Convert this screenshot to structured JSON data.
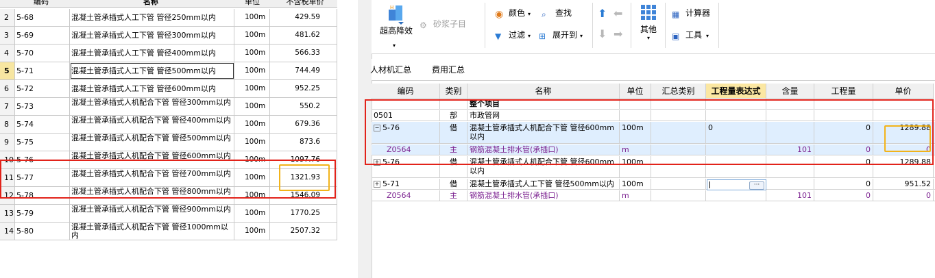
{
  "left_table": {
    "headers": {
      "code": "编码",
      "name": "名称",
      "unit": "单位",
      "price": "不含税单价"
    },
    "rows": [
      {
        "num": "2",
        "code": "5-68",
        "name": "混凝土管承插式人工下管 管径250mm以内",
        "unit": "100m",
        "price": "429.59"
      },
      {
        "num": "3",
        "code": "5-69",
        "name": "混凝土管承插式人工下管 管径300mm以内",
        "unit": "100m",
        "price": "481.62"
      },
      {
        "num": "4",
        "code": "5-70",
        "name": "混凝土管承插式人工下管 管径400mm以内",
        "unit": "100m",
        "price": "566.33"
      },
      {
        "num": "5",
        "code": "5-71",
        "name": "混凝土管承插式人工下管 管径500mm以内",
        "unit": "100m",
        "price": "744.49"
      },
      {
        "num": "6",
        "code": "5-72",
        "name": "混凝土管承插式人工下管 管径600mm以内",
        "unit": "100m",
        "price": "952.25"
      },
      {
        "num": "7",
        "code": "5-73",
        "name": "混凝土管承插式人机配合下管 管径300mm以内",
        "unit": "100m",
        "price": "550.2"
      },
      {
        "num": "8",
        "code": "5-74",
        "name": "混凝土管承插式人机配合下管 管径400mm以内",
        "unit": "100m",
        "price": "679.36"
      },
      {
        "num": "9",
        "code": "5-75",
        "name": "混凝土管承插式人机配合下管 管径500mm以内",
        "unit": "100m",
        "price": "873.6"
      },
      {
        "num": "10",
        "code": "5-76",
        "name": "混凝土管承插式人机配合下管 管径600mm以内",
        "unit": "100m",
        "price": "1097.76"
      },
      {
        "num": "11",
        "code": "5-77",
        "name": "混凝土管承插式人机配合下管 管径700mm以内",
        "unit": "100m",
        "price": "1321.93"
      },
      {
        "num": "12",
        "code": "5-78",
        "name": "混凝土管承插式人机配合下管 管径800mm以内",
        "unit": "100m",
        "price": "1546.09"
      },
      {
        "num": "13",
        "code": "5-79",
        "name": "混凝土管承插式人机配合下管 管径900mm以内",
        "unit": "100m",
        "price": "1770.25"
      },
      {
        "num": "14",
        "code": "5-80",
        "name": "混凝土管承插式人机配合下管 管径1000mm以内",
        "unit": "100m",
        "price": "2507.32"
      }
    ]
  },
  "toolbar": {
    "super_high": "超高降效",
    "mortar": "砂浆子目",
    "color": "颜色",
    "find": "查找",
    "filter": "过滤",
    "expand": "展开到",
    "other": "其他",
    "calculator": "计算器",
    "tools": "工具"
  },
  "tabs": {
    "labor_summary": "人材机汇总",
    "fee_summary": "费用汇总"
  },
  "grid": {
    "headers": {
      "code": "编码",
      "category": "类别",
      "name": "名称",
      "unit": "单位",
      "sum_category": "汇总类别",
      "qty_expr": "工程量表达式",
      "content": "含量",
      "qty": "工程量",
      "price": "单价"
    },
    "rows": [
      {
        "code": "",
        "category": "",
        "name": "整个项目",
        "unit": "",
        "expr": "",
        "content": "",
        "qty": "",
        "price": ""
      },
      {
        "code": "0501",
        "category": "部",
        "name": "市政管网",
        "unit": "",
        "expr": "",
        "content": "",
        "qty": "",
        "price": ""
      },
      {
        "code": "5-76",
        "category": "借",
        "name": "混凝土管承插式人机配合下管 管径600mm以内",
        "unit": "100m",
        "expr": "0",
        "content": "",
        "qty": "0",
        "price": "1289.88"
      },
      {
        "code": "Z0564",
        "category": "主",
        "name": "钢筋混凝土排水管(承插口)",
        "unit": "m",
        "expr": "",
        "content": "101",
        "qty": "0",
        "price": "0"
      },
      {
        "code": "5-76",
        "category": "借",
        "name": "混凝土管承插式人机配合下管 管径600mm以内",
        "unit": "100m",
        "expr": "",
        "content": "",
        "qty": "0",
        "price": "1289.88"
      },
      {
        "code": "5-71",
        "category": "借",
        "name": "混凝土管承插式人工下管 管径500mm以内",
        "unit": "100m",
        "expr": "",
        "content": "",
        "qty": "0",
        "price": "951.52"
      },
      {
        "code": "Z0564",
        "category": "主",
        "name": "钢筋混凝土排水管(承插口)",
        "unit": "m",
        "expr": "",
        "content": "101",
        "qty": "0",
        "price": "0"
      }
    ]
  },
  "icons": [
    "super-high-icon",
    "mortar-icon",
    "color-icon",
    "find-icon",
    "filter-icon",
    "expand-icon",
    "arrow-up-icon",
    "arrow-left-icon",
    "arrow-down-icon",
    "arrow-right-icon",
    "other-grid-icon",
    "calculator-icon",
    "tools-icon"
  ],
  "colors": {
    "highlight_red": "#e2231a",
    "highlight_yellow": "#f2b31a",
    "header_active": "#fbe7a2",
    "main_material": "#7a1f8f"
  }
}
